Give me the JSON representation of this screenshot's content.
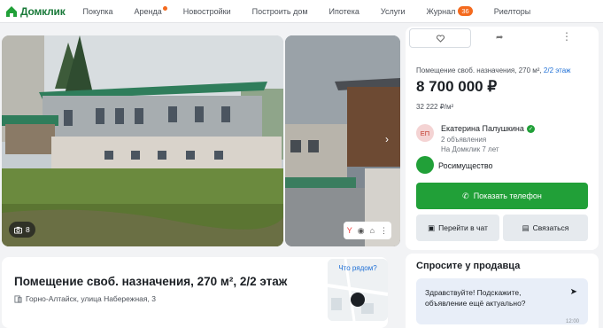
{
  "header": {
    "logo_text": "Домклик",
    "nav": [
      {
        "label": "Покупка"
      },
      {
        "label": "Аренда"
      },
      {
        "label": "Новостройки"
      },
      {
        "label": "Построить дом"
      },
      {
        "label": "Ипотека"
      },
      {
        "label": "Услуги"
      },
      {
        "label": "Журнал",
        "badge": "36"
      },
      {
        "label": "Риелторы"
      }
    ]
  },
  "gallery": {
    "photo_count": "8"
  },
  "listing": {
    "title": "Помещение своб. назначения, 270 м², 2/2 этаж",
    "address": "Горно-Алтайск, улица Набережная, 3",
    "nearby_label": "Что рядом?"
  },
  "side": {
    "subtitle_main": "Помещение своб. назначения, 270 м², ",
    "subtitle_floor": "2/2 этаж",
    "price": "8 700 000 ₽",
    "price_per_m2": "32 222 ₽/м²",
    "agent_initials": "ЕП",
    "agent_name": "Екатерина Палушкина",
    "agent_ads": "2 объявления",
    "agent_since": "На Домклик 7 лет",
    "agency": "Росимущество",
    "show_phone": "Показать телефон",
    "chat": "Перейти в чат",
    "contact": "Связаться"
  },
  "ask": {
    "title": "Спросите у продавца",
    "message": "Здравствуйте! Подскажите, объявление ещё актуально?",
    "time": "12:00"
  },
  "colors": {
    "brand_green": "#21a038",
    "accent_orange": "#f46a1e",
    "link_blue": "#1e6fd6"
  }
}
